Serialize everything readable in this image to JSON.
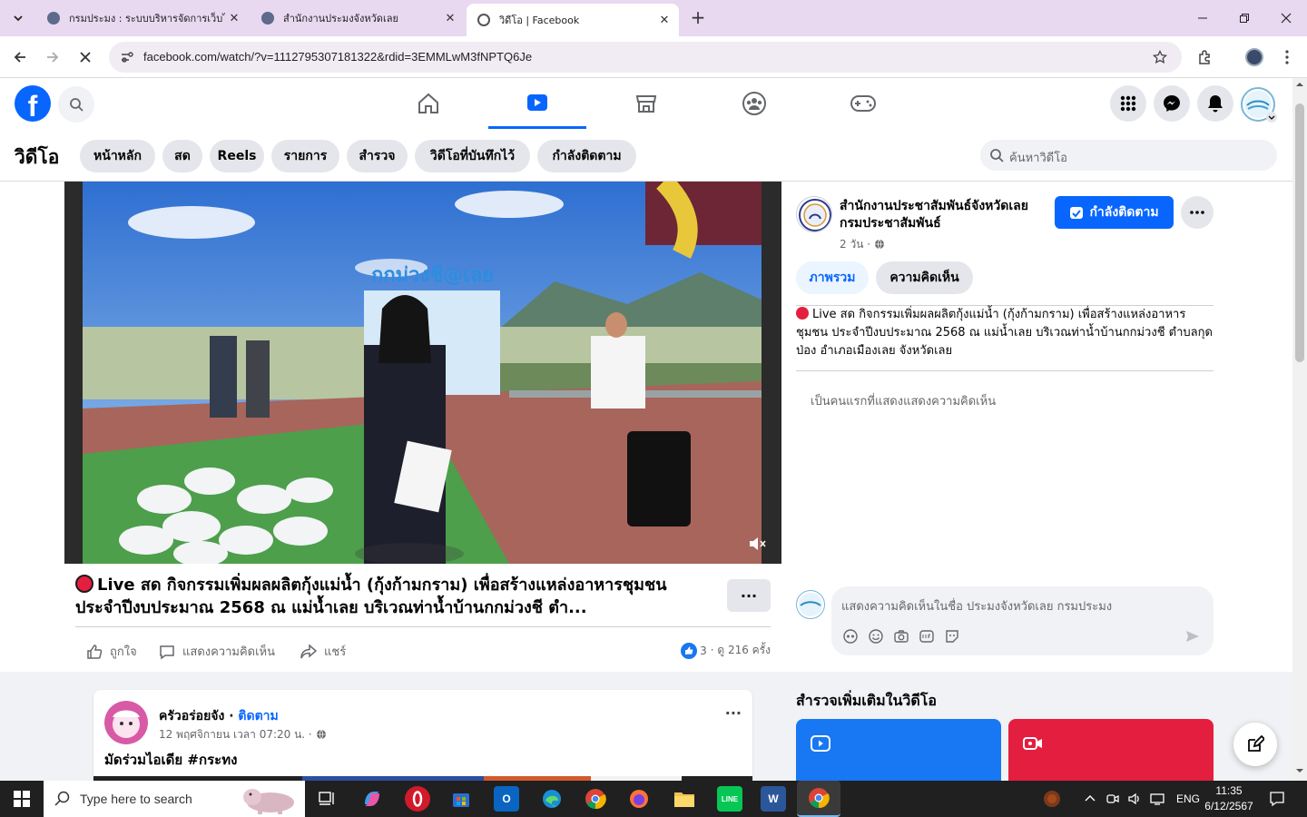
{
  "browser": {
    "tabs": [
      {
        "title": "กรมประมง : ระบบบริหารจัดการเว็บไซต์",
        "active": false
      },
      {
        "title": "สำนักงานประมงจังหวัดเลย",
        "active": false
      },
      {
        "title": "วิดีโอ | Facebook",
        "active": true
      }
    ],
    "url": "facebook.com/watch/?v=1112795307181322&rdid=3EMMLwM3fNPTQ6Je"
  },
  "colors": {
    "brand": "#0866ff",
    "live": "#e41e3f",
    "tab_strip": "#e8d8f0"
  },
  "video_page": {
    "title": "วิดีโอ",
    "pills": [
      "หน้าหลัก",
      "สด",
      "Reels",
      "รายการ",
      "สำรวจ",
      "วิดีโอที่บันทึกไว้",
      "กำลังติดตาม"
    ],
    "search_placeholder": "ค้นหาวิดีโอ"
  },
  "post": {
    "title": "Live สด กิจกรรมเพิ่มผลผลิตกุ้งแม่น้ำ (กุ้งก้ามกราม) เพื่อสร้างแหล่งอาหารชุมชน ประจำปีงบประมาณ 2568 ณ แม่น้ำเลย บริเวณท่าน้ำบ้านกกม่วงชี ตำ...",
    "actions": {
      "like": "ถูกใจ",
      "comment": "แสดงความคิดเห็น",
      "share": "แชร์"
    },
    "reactions": "3",
    "views": "· ดู 216 ครั้ง",
    "more": "···"
  },
  "sidebar": {
    "page_name": "สำนักงานประชาสัมพันธ์จังหวัดเลย กรมประชาสัมพันธ์",
    "time": "2 วัน ·",
    "follow_label": "กำลังติดตาม",
    "tabs": [
      "ภาพรวม",
      "ความคิดเห็น"
    ],
    "description": "Live สด กิจกรรมเพิ่มผลผลิตกุ้งแม่น้ำ (กุ้งก้ามกราม) เพื่อสร้างแหล่งอาหารชุมชน ประจำปีงบประมาณ 2568 ณ แม่น้ำเลย บริเวณท่าน้ำบ้านกกม่วงชี ตำบลกุดป่อง อำเภอเมืองเลย จังหวัดเลย",
    "first_comment": "เป็นคนแรกที่แสดงแสดงความคิดเห็น",
    "comment_placeholder": "แสดงความคิดเห็นในชื่อ ประมงจังหวัดเลย กรมประมง",
    "explore_title": "สำรวจเพิ่มเติมในวิดีโอ"
  },
  "feed": {
    "name": "ครัวอร่อยจัง",
    "follow": "ติดตาม",
    "meta": "12 พฤศจิกายน เวลา 07:20 น. ·",
    "text": "มัดร่วมไอเดีย #กระทง"
  },
  "taskbar": {
    "search_placeholder": "Type here to search",
    "lang": "ENG",
    "time": "11:35",
    "date": "6/12/2567"
  }
}
